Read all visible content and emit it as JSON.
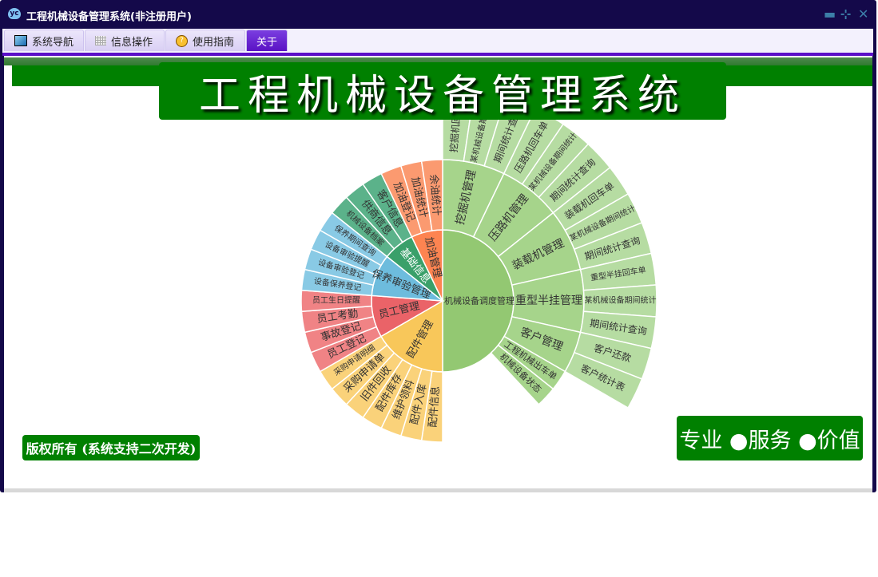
{
  "window": {
    "title": "工程机械设备管理系统(非注册用户)",
    "controls": [
      "minimize",
      "restore",
      "close"
    ]
  },
  "tabs": [
    {
      "label": "系统导航",
      "icon": "monitor-icon"
    },
    {
      "label": "信息操作",
      "icon": "grid-icon"
    },
    {
      "label": "使用指南",
      "icon": "help-icon"
    },
    {
      "label": "关于",
      "active": true
    }
  ],
  "banner": {
    "title": "工程机械设备管理系统"
  },
  "footer": {
    "copyright": "版权所有 (系统支持二次开发)",
    "slogan": "专业 ●服务 ●价值"
  },
  "colors": {
    "titlebar": "#14094a",
    "accent": "#5b0fc8",
    "green": "#008000"
  },
  "sunburst": {
    "root": {
      "name": "机械设备调度管理",
      "color": "#93c872",
      "color2": "#a6d48b",
      "color3": "#b6dca2",
      "children": [
        {
          "name": "挖掘机管理",
          "children": [
            "挖掘机回车单",
            "某机械设备期间统计",
            "期间统计查询"
          ]
        },
        {
          "name": "压路机管理",
          "children": [
            "压路机回车单",
            "某机械设备期间统计",
            "期间统计查询"
          ]
        },
        {
          "name": "装载机管理",
          "children": [
            "装载机回车单",
            "某机械设备期间统计",
            "期间统计查询"
          ]
        },
        {
          "name": "重型半挂管理",
          "children": [
            "重型半挂回车单",
            "某机械设备期间统计",
            "期间统计查询"
          ]
        },
        {
          "name": "客户管理",
          "children": [
            "客户还款",
            "客户统计表"
          ]
        },
        {
          "name": "工程机械出车单",
          "children": []
        },
        {
          "name": "机械设备状态",
          "children": []
        }
      ]
    },
    "groups": [
      {
        "name": "配件管理",
        "color": "#f8c75a",
        "color2": "#fad27a",
        "children": [
          "配件信息",
          "配件入库",
          "维护领料",
          "配件库存",
          "旧件回收",
          "采购申请单",
          "采购申请明细"
        ]
      },
      {
        "name": "员工管理",
        "color": "#ea6368",
        "color2": "#f08385",
        "children": [
          "员工登记",
          "事故登记",
          "员工考勤",
          "员工生日提醒"
        ]
      },
      {
        "name": "保养审验管理",
        "color": "#6dbcdd",
        "color2": "#89cae5",
        "children": [
          "设备保养登记",
          "设备审验登记",
          "设备审验提醒",
          "保养期间查询"
        ]
      },
      {
        "name": "基础信息",
        "color": "#3aa06a",
        "color2": "#5bb28a",
        "children": [
          "机械设备档案",
          "供商信息",
          "客户信息"
        ]
      },
      {
        "name": "加油管理",
        "color": "#fd8451",
        "color2": "#fb9a70",
        "children": [
          "加油登记",
          "加油统计",
          "余油统计"
        ]
      }
    ]
  }
}
